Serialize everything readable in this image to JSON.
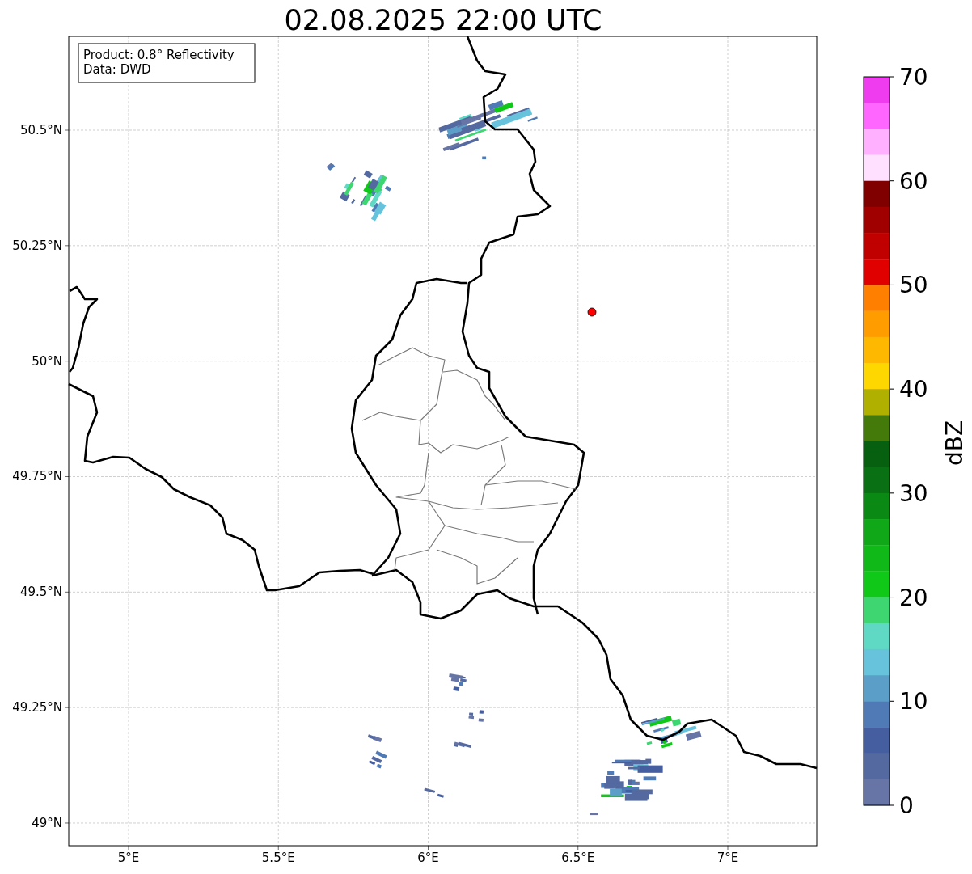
{
  "title": "02.08.2025 22:00 UTC",
  "info_box": {
    "lines": [
      "Product: 0.8° Reflectivity",
      "Data: DWD"
    ]
  },
  "map": {
    "lon_labels": [
      "5°E",
      "5.5°E",
      "6°E",
      "6.5°E",
      "7°E"
    ],
    "lat_labels": [
      "50.5°N",
      "50.25°N",
      "50°N",
      "49.75°N",
      "49.5°N",
      "49.25°N",
      "49°N"
    ]
  },
  "colorbar": {
    "label": "dBZ",
    "ticks": [
      "70",
      "60",
      "50",
      "40",
      "30",
      "20",
      "10",
      "0"
    ],
    "bins": [
      {
        "color": "#ee3cee"
      },
      {
        "color": "#ff66ff"
      },
      {
        "color": "#ffb0ff"
      },
      {
        "color": "#ffe0ff"
      },
      {
        "color": "#800000"
      },
      {
        "color": "#a00000"
      },
      {
        "color": "#c00000"
      },
      {
        "color": "#e00000"
      },
      {
        "color": "#ff7f00"
      },
      {
        "color": "#ff9c00"
      },
      {
        "color": "#ffb800"
      },
      {
        "color": "#ffd700"
      },
      {
        "color": "#b0b000"
      },
      {
        "color": "#447a0a"
      },
      {
        "color": "#066010"
      },
      {
        "color": "#0a7014"
      },
      {
        "color": "#0a8a14"
      },
      {
        "color": "#10a818"
      },
      {
        "color": "#10b818"
      },
      {
        "color": "#10c818"
      },
      {
        "color": "#3dd671"
      },
      {
        "color": "#5fd8c4"
      },
      {
        "color": "#67c2db"
      },
      {
        "color": "#5b9ec8"
      },
      {
        "color": "#4f7ab5"
      },
      {
        "color": "#445ea0"
      },
      {
        "color": "#5469a0"
      },
      {
        "color": "#6675a6"
      }
    ]
  }
}
